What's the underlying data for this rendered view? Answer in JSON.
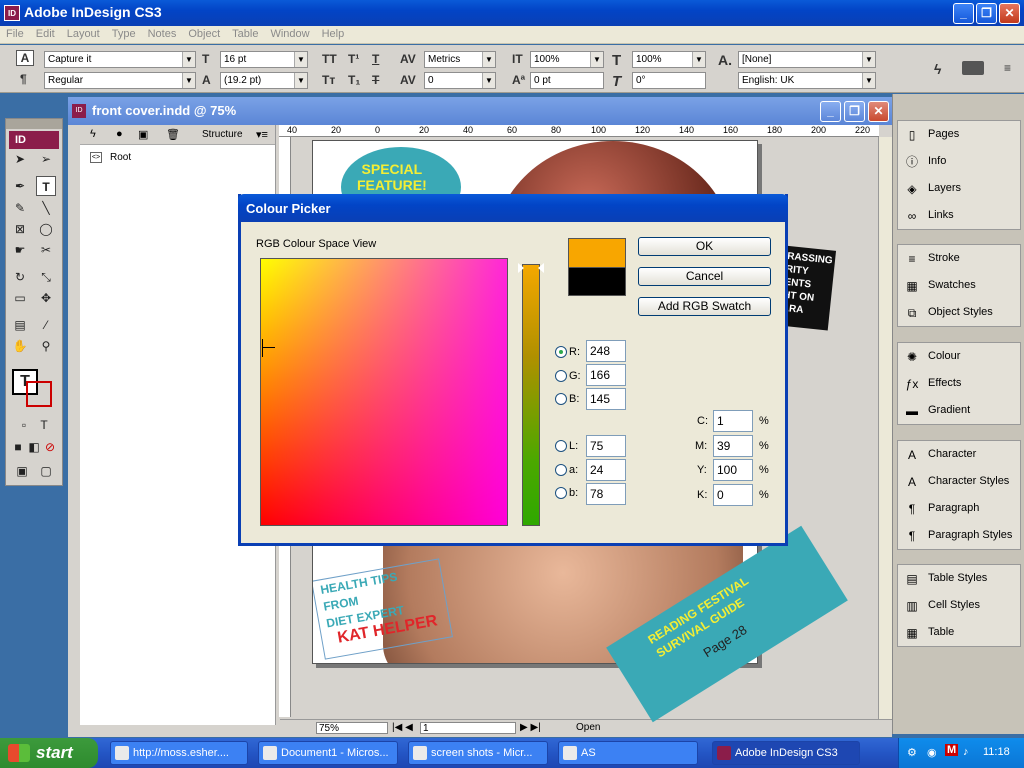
{
  "app": {
    "title": "Adobe InDesign CS3",
    "logo": "ID",
    "win_minimize": "_",
    "win_restore": "❐",
    "win_close": "✕"
  },
  "menu": [
    "File",
    "Edit",
    "Layout",
    "Type",
    "Notes",
    "Object",
    "Table",
    "Window",
    "Help"
  ],
  "control_panel": {
    "font_family": "Capture it",
    "font_style": "Regular",
    "font_size": "16 pt",
    "leading": "(19.2 pt)",
    "kerning": "Metrics",
    "tracking": "0",
    "vertical_scale": "100%",
    "horizontal_scale": "100%",
    "baseline_shift": "0 pt",
    "skew": "0°",
    "char_style": "[None]",
    "language": "English: UK"
  },
  "document": {
    "title": "front cover.indd @ 75%",
    "structure_label": "Structure",
    "root_label": "Root",
    "zoom": "75%",
    "page_number": "1",
    "status": "Open",
    "ruler_ticks": [
      "40",
      "20",
      "0",
      "20",
      "40",
      "60",
      "80",
      "100",
      "120",
      "140",
      "160",
      "180",
      "200",
      "220"
    ],
    "cover_text": {
      "bubble_line1": "SPECIAL",
      "bubble_line2": "FEATURE!",
      "health_line1": "HEALTH TIPS",
      "health_line2": "FROM",
      "health_line3": "DIET EXPERT",
      "health_name": "KAT HELPER",
      "banner_line1": "READING FESTIVAL",
      "banner_line2": "SURVIVAL GUIDE",
      "banner_page": "Page 28",
      "side_line1": "RASSING",
      "side_line2": "RITY",
      "side_line3": "ENTS",
      "side_line4": "HT ON",
      "side_line5": "ARA"
    }
  },
  "panels": {
    "group1": [
      "Pages",
      "Info",
      "Layers",
      "Links"
    ],
    "group2": [
      "Stroke",
      "Swatches",
      "Object Styles"
    ],
    "group3": [
      "Colour",
      "Effects",
      "Gradient"
    ],
    "group4": [
      "Character",
      "Character Styles",
      "Paragraph",
      "Paragraph Styles"
    ],
    "group5": [
      "Table Styles",
      "Cell Styles",
      "Table"
    ]
  },
  "colour_picker": {
    "title": "Colour Picker",
    "space_label": "RGB Colour Space View",
    "ok": "OK",
    "cancel": "Cancel",
    "add_swatch": "Add RGB Swatch",
    "new_colour": "#f8a600",
    "old_colour": "#000000",
    "rgb": {
      "r_label": "R:",
      "r": "248",
      "g_label": "G:",
      "g": "166",
      "b_label": "B:",
      "b": "145"
    },
    "lab": {
      "l_label": "L:",
      "l": "75",
      "a_label": "a:",
      "a": "24",
      "b_label": "b:",
      "b": "78"
    },
    "cmyk": {
      "c_label": "C:",
      "c": "1",
      "m_label": "M:",
      "m": "39",
      "y_label": "Y:",
      "y": "100",
      "k_label": "K:",
      "k": "0",
      "unit": "%"
    }
  },
  "taskbar": {
    "start": "start",
    "tasks": [
      "http://moss.esher....",
      "Document1 - Micros...",
      "screen shots - Micr...",
      "AS",
      "Adobe InDesign CS3"
    ],
    "time": "11:18"
  }
}
